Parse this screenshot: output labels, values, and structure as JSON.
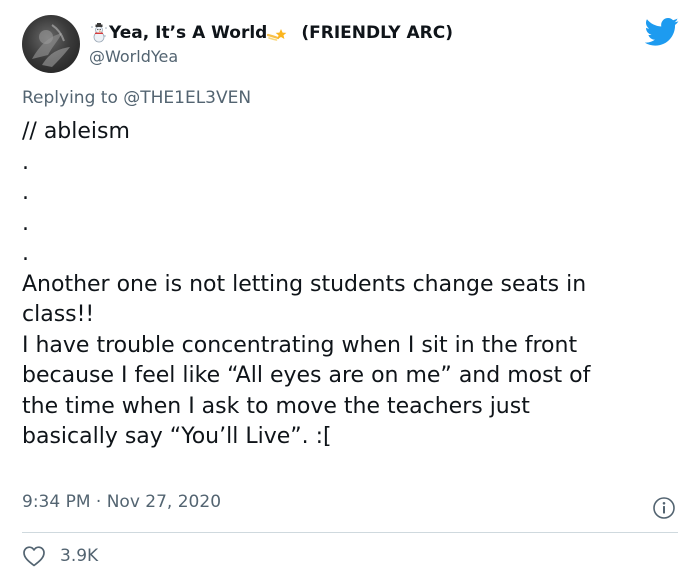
{
  "author": {
    "name": "Yea, It’s A World",
    "suffix": "(FRIENDLY ARC)",
    "handle": "@WorldYea",
    "name_prefix_emoji_icon": "snowman-icon",
    "name_suffix_emoji_icon": "shooting-star-icon"
  },
  "reply": {
    "prefix": "Replying to",
    "mention": "@THE1EL3VEN"
  },
  "body": {
    "lines": [
      "// ableism",
      ".",
      ".",
      ".",
      ".",
      "",
      "Another one is not letting students change seats in",
      "class!!",
      "I have trouble concentrating when I sit in the front",
      "because I feel like “All eyes are on me” and most of",
      "the time when I ask to move the teachers just",
      "basically say “You’ll Live”. :["
    ]
  },
  "meta": {
    "time": "9:34 PM",
    "separator": "·",
    "date": "Nov 27, 2020"
  },
  "engagement": {
    "likes": "3.9K"
  },
  "colors": {
    "text": "#0f1419",
    "secondary": "#536471",
    "twitter_blue": "#1d9bf0",
    "divider": "#cfd9de"
  },
  "icons": [
    "avatar",
    "twitter-bird-icon",
    "info-icon",
    "heart-icon"
  ]
}
